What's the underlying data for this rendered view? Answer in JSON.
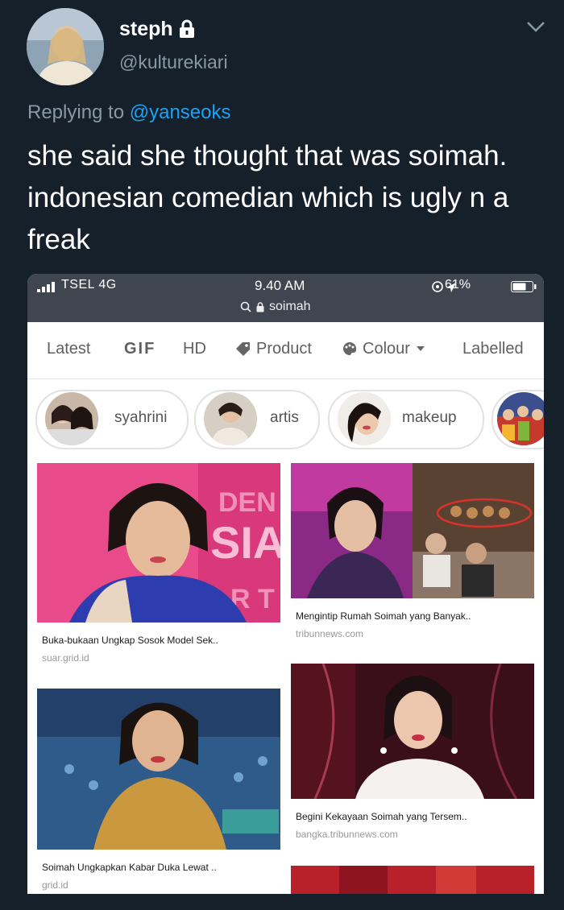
{
  "tweet": {
    "display_name": "steph",
    "handle": "@kulturekiari",
    "replying_prefix": "Replying to",
    "replying_to": "@yanseoks",
    "text": "she said she thought that was soimah. indonesian comedian which is ugly n a freak"
  },
  "phone": {
    "status": {
      "carrier": "TSEL 4G",
      "time": "9.40 AM",
      "battery": "61%"
    },
    "search_query": "soimah",
    "tabs": [
      "Latest",
      "GIF",
      "HD",
      "Product",
      "Colour",
      "Labelled"
    ],
    "chips": [
      "syahrini",
      "artis",
      "makeup"
    ],
    "results": [
      {
        "title": "Buka-bukaan Ungkap Sosok Model Sek..",
        "source": "suar.grid.id"
      },
      {
        "title": "Mengintip Rumah Soimah yang Banyak..",
        "source": "tribunnews.com"
      },
      {
        "title": "Soimah Ungkapkan Kabar Duka Lewat ..",
        "source": "grid.id"
      },
      {
        "title": "Begini Kekayaan Soimah yang Tersem..",
        "source": "bangka.tribunnews.com"
      }
    ]
  },
  "colors": {
    "background": "#16202b",
    "mention": "#1da1f2",
    "muted": "#8899a6"
  }
}
